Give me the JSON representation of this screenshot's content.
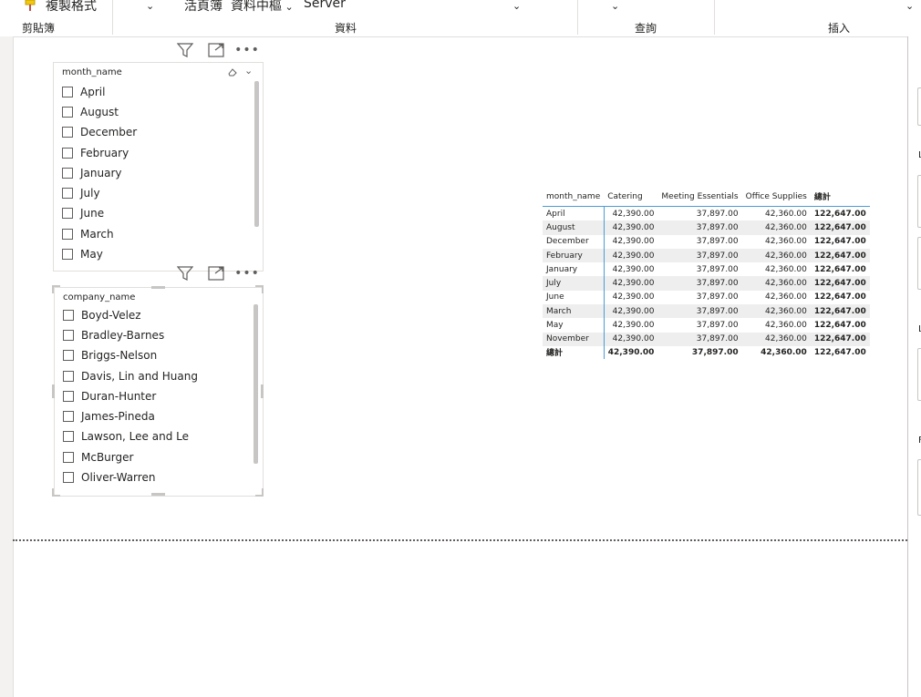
{
  "ribbon": {
    "format_painter_label": "複製格式",
    "groups": {
      "clipboard": "剪貼簿",
      "data": "資料",
      "query": "查詢",
      "insert": "插入"
    },
    "data_items": {
      "workbook": "活頁簿",
      "datahub": "資料中樞",
      "server": "Server"
    }
  },
  "month_slicer": {
    "title": "month_name",
    "items": [
      "April",
      "August",
      "December",
      "February",
      "January",
      "July",
      "June",
      "March",
      "May"
    ]
  },
  "company_slicer": {
    "title": "company_name",
    "items": [
      "Boyd-Velez",
      "Bradley-Barnes",
      "Briggs-Nelson",
      "Davis, Lin and Huang",
      "Duran-Hunter",
      "James-Pineda",
      "Lawson, Lee and Le",
      "McBurger",
      "Oliver-Warren"
    ]
  },
  "matrix": {
    "headers": [
      "month_name",
      "Catering",
      "Meeting Essentials",
      "Office Supplies",
      "總計"
    ],
    "rows": [
      [
        "April",
        "42,390.00",
        "37,897.00",
        "42,360.00",
        "122,647.00"
      ],
      [
        "August",
        "42,390.00",
        "37,897.00",
        "42,360.00",
        "122,647.00"
      ],
      [
        "December",
        "42,390.00",
        "37,897.00",
        "42,360.00",
        "122,647.00"
      ],
      [
        "February",
        "42,390.00",
        "37,897.00",
        "42,360.00",
        "122,647.00"
      ],
      [
        "January",
        "42,390.00",
        "37,897.00",
        "42,360.00",
        "122,647.00"
      ],
      [
        "July",
        "42,390.00",
        "37,897.00",
        "42,360.00",
        "122,647.00"
      ],
      [
        "June",
        "42,390.00",
        "37,897.00",
        "42,360.00",
        "122,647.00"
      ],
      [
        "March",
        "42,390.00",
        "37,897.00",
        "42,360.00",
        "122,647.00"
      ],
      [
        "May",
        "42,390.00",
        "37,897.00",
        "42,360.00",
        "122,647.00"
      ],
      [
        "November",
        "42,390.00",
        "37,897.00",
        "42,360.00",
        "122,647.00"
      ]
    ],
    "total": [
      "總計",
      "42,390.00",
      "37,897.00",
      "42,360.00",
      "122,647.00"
    ]
  },
  "colors": {
    "accent": "#4a9cd6",
    "zebra": "#eeeeee",
    "page_break": "#605e5c"
  }
}
